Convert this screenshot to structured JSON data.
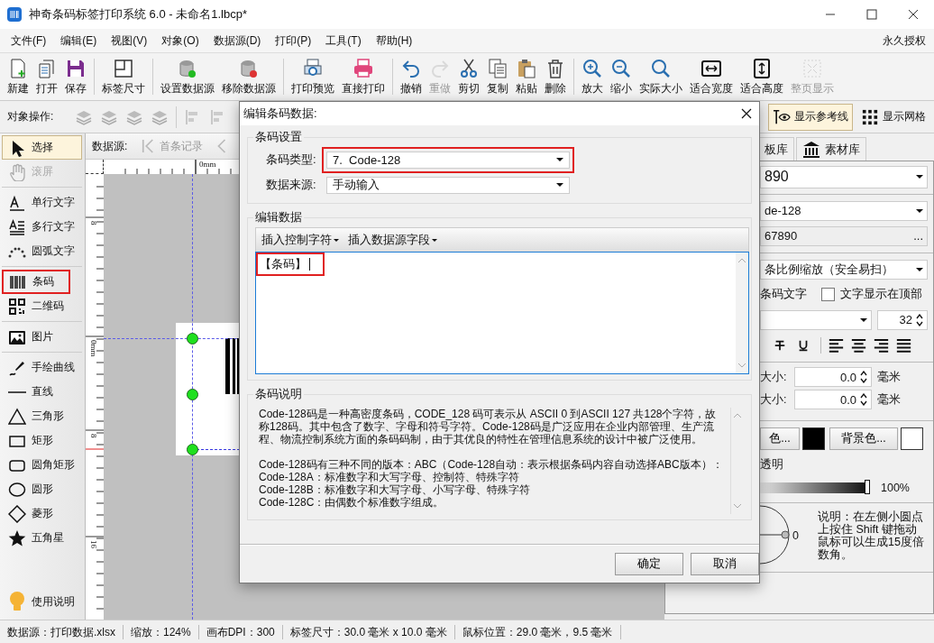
{
  "window": {
    "title": "神奇条码标签打印系统 6.0 - 未命名1.lbcp*"
  },
  "menu": {
    "items": [
      "文件(F)",
      "编辑(E)",
      "视图(V)",
      "对象(O)",
      "数据源(D)",
      "打印(P)",
      "工具(T)",
      "帮助(H)"
    ],
    "license": "永久授权"
  },
  "toolbar": [
    [
      {
        "label": "新建",
        "disabled": false
      },
      {
        "label": "打开",
        "disabled": false
      },
      {
        "label": "保存",
        "disabled": false
      }
    ],
    [
      {
        "label": "标签尺寸",
        "disabled": false
      }
    ],
    [
      {
        "label": "设置数据源",
        "disabled": false
      },
      {
        "label": "移除数据源",
        "disabled": false
      }
    ],
    [
      {
        "label": "打印预览",
        "disabled": false
      },
      {
        "label": "直接打印",
        "disabled": false
      }
    ],
    [
      {
        "label": "撤销",
        "disabled": false
      },
      {
        "label": "重做",
        "disabled": true
      },
      {
        "label": "剪切",
        "disabled": false
      },
      {
        "label": "复制",
        "disabled": false
      },
      {
        "label": "粘贴",
        "disabled": false
      },
      {
        "label": "删除",
        "disabled": false
      }
    ],
    [
      {
        "label": "放大",
        "disabled": false
      },
      {
        "label": "缩小",
        "disabled": false
      },
      {
        "label": "实际大小",
        "disabled": false
      },
      {
        "label": "适合宽度",
        "disabled": false
      },
      {
        "label": "适合高度",
        "disabled": false
      },
      {
        "label": "整页显示",
        "disabled": true
      }
    ]
  ],
  "object_bar": {
    "label": "对象操作:",
    "toggles": [
      {
        "label": "显示参考线",
        "on": true
      },
      {
        "label": "显示网格",
        "on": false
      }
    ]
  },
  "tools": [
    [
      {
        "label": "选择",
        "selected": true,
        "disabled": false,
        "highlighted": false
      },
      {
        "label": "滚屏",
        "selected": false,
        "disabled": true,
        "highlighted": false
      }
    ],
    [
      {
        "label": "单行文字",
        "selected": false,
        "disabled": false,
        "highlighted": false
      },
      {
        "label": "多行文字",
        "selected": false,
        "disabled": false,
        "highlighted": false
      },
      {
        "label": "圆弧文字",
        "selected": false,
        "disabled": false,
        "highlighted": false
      }
    ],
    [
      {
        "label": "条码",
        "selected": false,
        "disabled": false,
        "highlighted": true
      },
      {
        "label": "二维码",
        "selected": false,
        "disabled": false,
        "highlighted": false
      }
    ],
    [
      {
        "label": "图片",
        "selected": false,
        "disabled": false,
        "highlighted": false
      }
    ],
    [
      {
        "label": "手绘曲线",
        "selected": false,
        "disabled": false,
        "highlighted": false
      },
      {
        "label": "直线",
        "selected": false,
        "disabled": false,
        "highlighted": false
      },
      {
        "label": "三角形",
        "selected": false,
        "disabled": false,
        "highlighted": false
      },
      {
        "label": "矩形",
        "selected": false,
        "disabled": false,
        "highlighted": false
      },
      {
        "label": "圆角矩形",
        "selected": false,
        "disabled": false,
        "highlighted": false
      },
      {
        "label": "圆形",
        "selected": false,
        "disabled": false,
        "highlighted": false
      },
      {
        "label": "菱形",
        "selected": false,
        "disabled": false,
        "highlighted": false
      },
      {
        "label": "五角星",
        "selected": false,
        "disabled": false,
        "highlighted": false
      }
    ]
  ],
  "help": "使用说明",
  "canvas": {
    "data_source_label": "数据源:",
    "first_record": "首条记录",
    "h_ruler": [
      "0mm"
    ],
    "v_ruler": [
      "8",
      "0mm",
      "8",
      "16"
    ]
  },
  "right_panel": {
    "tabs": [
      {
        "label": "板库",
        "selected": false
      },
      {
        "label": "素材库",
        "selected": false
      }
    ],
    "code_value": "890",
    "barcode_type": "de-128",
    "data": "67890",
    "data_button": "...",
    "scale_mode": "条比例缩放（安全易扫）",
    "text_label": "条码文字",
    "text_top": {
      "label": "文字显示在顶部",
      "checked": false
    },
    "font_size": "32",
    "sizes": [
      {
        "label": "大小:",
        "value": "0.0",
        "unit": "毫米"
      },
      {
        "label": "大小:",
        "value": "0.0",
        "unit": "毫米"
      }
    ],
    "colors": [
      {
        "button": "色...",
        "color": "#000000"
      },
      {
        "button": "背景色...",
        "color": "#ffffff"
      }
    ],
    "transparent_label": "透明",
    "opacity": {
      "level": 1.0,
      "reading": "100%"
    },
    "angle": "0",
    "angle_note": "说明：在左侧小圆点上按住 Shift 键拖动鼠标可以生成15度倍数角。"
  },
  "dialog": {
    "title": "编辑条码数据:",
    "settings_group": "条码设置",
    "barcode_type": {
      "label": "条码类型:",
      "value": "7.  Code-128",
      "highlighted": true
    },
    "data_source": {
      "label": "数据来源:",
      "value": "手动输入",
      "highlighted": false
    },
    "edit_group": "编辑数据",
    "insert_menus": [
      "插入控制字符",
      "插入数据源字段"
    ],
    "data": {
      "value": "【条码】",
      "highlighted": true
    },
    "desc_group": "条码说明",
    "description": [
      "Code-128码是一种高密度条码，CODE_128 码可表示从 ASCII 0 到ASCII 127 共128个字符，故称128码。其中包含了数字、字母和符号字符。Code-128码是广泛应用在企业内部管理、生产流程、物流控制系统方面的条码码制，由于其优良的特性在管理信息系统的设计中被广泛使用。",
      "Code-128码有三种不同的版本：ABC（Code-128自动：表示根据条码内容自动选择ABC版本）：",
      "Code-128A：标准数字和大写字母、控制符、特殊字符",
      "Code-128B：标准数字和大写字母、小写字母、特殊字符",
      "Code-128C：由偶数个标准数字组成。"
    ],
    "buttons": [
      "确定",
      "取消"
    ]
  },
  "status_bar": [
    "数据源：打印数据.xlsx",
    "缩放：124%",
    "画布DPI：300",
    "标签尺寸：30.0 毫米 x 10.0 毫米",
    "鼠标位置：29.0 毫米，9.5 毫米"
  ]
}
